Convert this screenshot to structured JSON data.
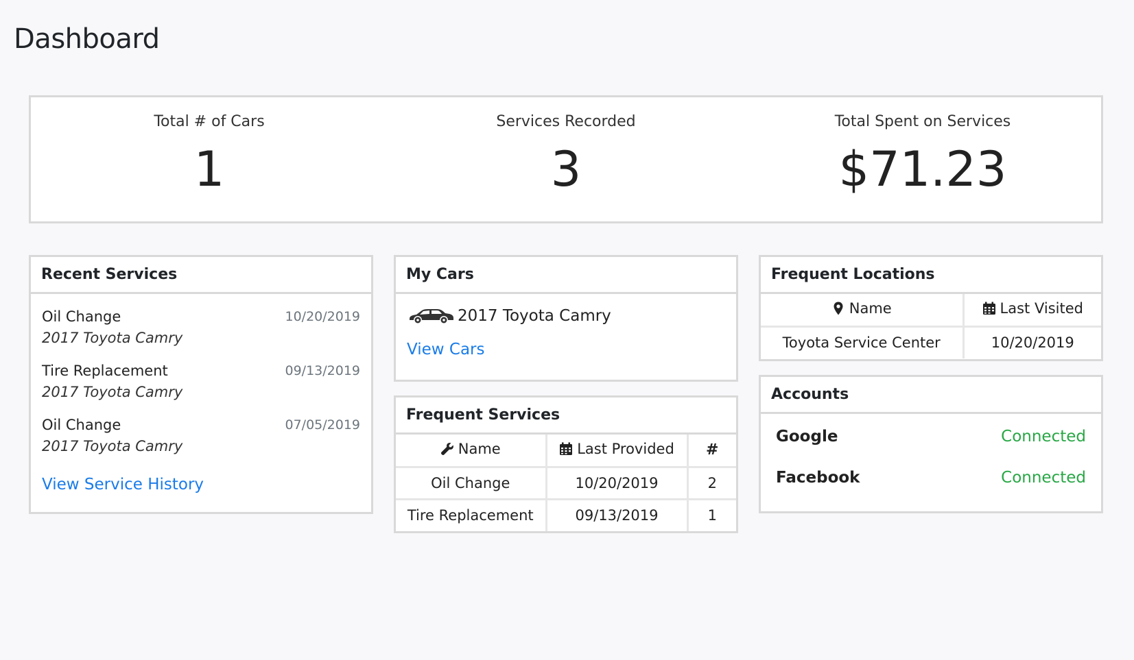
{
  "page": {
    "title": "Dashboard"
  },
  "summary": [
    {
      "label": "Total # of Cars",
      "value": "1"
    },
    {
      "label": "Services Recorded",
      "value": "3"
    },
    {
      "label": "Total Spent on Services",
      "value": "$71.23"
    }
  ],
  "recent_services": {
    "title": "Recent Services",
    "items": [
      {
        "name": "Oil Change",
        "car": "2017 Toyota Camry",
        "date": "10/20/2019"
      },
      {
        "name": "Tire Replacement",
        "car": "2017 Toyota Camry",
        "date": "09/13/2019"
      },
      {
        "name": "Oil Change",
        "car": "2017 Toyota Camry",
        "date": "07/05/2019"
      }
    ],
    "link_label": "View Service History"
  },
  "my_cars": {
    "title": "My Cars",
    "car_icon": "car-icon",
    "cars": [
      "2017 Toyota Camry"
    ],
    "link_label": "View Cars"
  },
  "frequent_services": {
    "title": "Frequent Services",
    "columns": [
      {
        "label": "Name",
        "icon": "wrench-icon"
      },
      {
        "label": "Last Provided",
        "icon": "calendar-icon"
      },
      {
        "label": "#"
      }
    ],
    "rows": [
      [
        "Oil Change",
        "10/20/2019",
        "2"
      ],
      [
        "Tire Replacement",
        "09/13/2019",
        "1"
      ]
    ]
  },
  "frequent_locations": {
    "title": "Frequent Locations",
    "columns": [
      {
        "label": "Name",
        "icon": "map-marker-icon"
      },
      {
        "label": "Last Visited",
        "icon": "calendar-icon"
      }
    ],
    "rows": [
      [
        "Toyota Service Center",
        "10/20/2019"
      ]
    ]
  },
  "accounts": {
    "title": "Accounts",
    "items": [
      {
        "name": "Google",
        "status": "Connected"
      },
      {
        "name": "Facebook",
        "status": "Connected"
      }
    ],
    "status_color": "#28a745"
  },
  "colors": {
    "link": "#1a7ce8",
    "border": "#d9d9d9",
    "background": "#f8f8fa"
  }
}
